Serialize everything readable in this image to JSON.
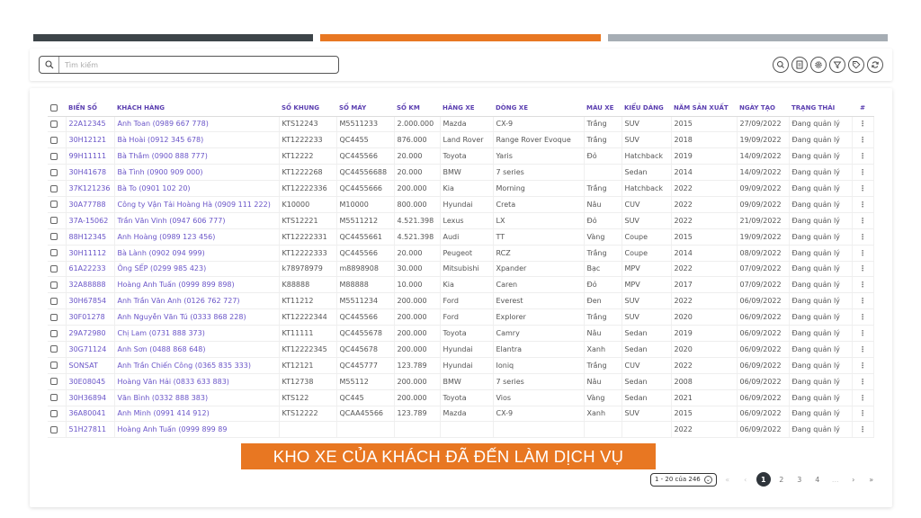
{
  "progress": {
    "colors": [
      "#3d4449",
      "#e87722",
      "#a6adb4"
    ]
  },
  "search": {
    "placeholder": "Tìm kiếm"
  },
  "toolbar": {
    "actions": [
      "search-icon",
      "document-icon",
      "settings-icon",
      "filter-icon",
      "tag-icon",
      "refresh-icon"
    ]
  },
  "table": {
    "headers": [
      "BIỂN SỐ",
      "KHÁCH HÀNG",
      "SỐ KHUNG",
      "SỐ MÁY",
      "SỐ KM",
      "HÃNG XE",
      "DÒNG XE",
      "MÀU XE",
      "KIỂU DÁNG",
      "NĂM SẢN XUẤT",
      "NGÀY TẠO",
      "TRẠNG THÁI",
      "#"
    ],
    "rows": [
      [
        "22A12345",
        "Anh Toan (0989 667 778)",
        "KTS12243",
        "M5511233",
        "2.000.000",
        "Mazda",
        "CX-9",
        "Trắng",
        "SUV",
        "2015",
        "27/09/2022",
        "Đang quản lý"
      ],
      [
        "30H12121",
        "Bà Hoài (0912 345 678)",
        "KT1222233",
        "QC4455",
        "876.000",
        "Land Rover",
        "Range Rover Evoque",
        "Trắng",
        "SUV",
        "2018",
        "19/09/2022",
        "Đang quản lý"
      ],
      [
        "99H11111",
        "Bà Thắm (0900 888 777)",
        "KT12222",
        "QC445566",
        "20.000",
        "Toyota",
        "Yaris",
        "Đỏ",
        "Hatchback",
        "2019",
        "14/09/2022",
        "Đang quản lý"
      ],
      [
        "30H41678",
        "Bà Tình (0900 909 000)",
        "KT1222268",
        "QC44556688",
        "20.000",
        "BMW",
        "7 series",
        "",
        "Sedan",
        "2014",
        "14/09/2022",
        "Đang quản lý"
      ],
      [
        "37K121236",
        "Bà To (0901 102 20)",
        "KT12222336",
        "QC4455666",
        "200.000",
        "Kia",
        "Morning",
        "Trắng",
        "Hatchback",
        "2022",
        "09/09/2022",
        "Đang quản lý"
      ],
      [
        "30A77788",
        "Công ty Vận Tải Hoàng Hà (0909 111 222)",
        "K10000",
        "M10000",
        "800.000",
        "Hyundai",
        "Creta",
        "Nâu",
        "CUV",
        "2022",
        "09/09/2022",
        "Đang quản lý"
      ],
      [
        "37A-15062",
        "Trần Văn Vinh (0947 606 777)",
        "KTS12221",
        "M5511212",
        "4.521.398",
        "Lexus",
        "LX",
        "Đỏ",
        "SUV",
        "2022",
        "21/09/2022",
        "Đang quản lý"
      ],
      [
        "88H12345",
        "Anh Hoàng (0989 123 456)",
        "KT12222331",
        "QC4455661",
        "4.521.398",
        "Audi",
        "TT",
        "Vàng",
        "Coupe",
        "2015",
        "19/09/2022",
        "Đang quản lý"
      ],
      [
        "30H11112",
        "Bà Lành (0902 094 999)",
        "KT12222333",
        "QC445566",
        "20.000",
        "Peugeot",
        "RCZ",
        "Trắng",
        "Coupe",
        "2014",
        "08/09/2022",
        "Đang quản lý"
      ],
      [
        "61A22233",
        "Ông SẾP (0299 985 423)",
        "k78978979",
        "m8898908",
        "30.000",
        "Mitsubishi",
        "Xpander",
        "Bạc",
        "MPV",
        "2022",
        "07/09/2022",
        "Đang quản lý"
      ],
      [
        "32A88888",
        "Hoàng Anh Tuấn (0999 899 898)",
        "K88888",
        "M88888",
        "10.000",
        "Kia",
        "Caren",
        "Đỏ",
        "MPV",
        "2017",
        "07/09/2022",
        "Đang quản lý"
      ],
      [
        "30H67854",
        "Anh Trần Văn Anh (0126 762 727)",
        "KT11212",
        "M5511234",
        "200.000",
        "Ford",
        "Everest",
        "Đen",
        "SUV",
        "2022",
        "06/09/2022",
        "Đang quản lý"
      ],
      [
        "30F01278",
        "Anh Nguyễn Văn Tú (0333 868 228)",
        "KT12222344",
        "QC445566",
        "200.000",
        "Ford",
        "Explorer",
        "Trắng",
        "SUV",
        "2020",
        "06/09/2022",
        "Đang quản lý"
      ],
      [
        "29A72980",
        "Chị Lam (0731 888 373)",
        "KT11111",
        "QC4455678",
        "200.000",
        "Toyota",
        "Camry",
        "Nâu",
        "Sedan",
        "2019",
        "06/09/2022",
        "Đang quản lý"
      ],
      [
        "30G71124",
        "Anh Sơn (0488 868 648)",
        "KT12222345",
        "QC445678",
        "200.000",
        "Hyundai",
        "Elantra",
        "Xanh",
        "Sedan",
        "2020",
        "06/09/2022",
        "Đang quản lý"
      ],
      [
        "SONSAT",
        "Anh Trần Chiến Công (0365 835 333)",
        "KT12121",
        "QC445777",
        "123.789",
        "Hyundai",
        "Ioniq",
        "Trắng",
        "CUV",
        "2022",
        "06/09/2022",
        "Đang quản lý"
      ],
      [
        "30E08045",
        "Hoàng Văn Hải (0833 633 883)",
        "KT12738",
        "M55112",
        "200.000",
        "BMW",
        "7 series",
        "Nâu",
        "Sedan",
        "2008",
        "06/09/2022",
        "Đang quản lý"
      ],
      [
        "30H36894",
        "Văn Bình (0332 888 383)",
        "KTS122",
        "QC445",
        "200.000",
        "Toyota",
        "Vios",
        "Vàng",
        "Sedan",
        "2021",
        "06/09/2022",
        "Đang quản lý"
      ],
      [
        "36A80041",
        "Anh Minh (0991 414 912)",
        "KTS12222",
        "QCAA45566",
        "123.789",
        "Mazda",
        "CX-9",
        "Xanh",
        "SUV",
        "2015",
        "06/09/2022",
        "Đang quản lý"
      ],
      [
        "51H27811",
        "Hoàng Anh Tuấn (0999 899 89",
        "",
        "",
        "",
        "",
        "",
        "",
        "",
        "2022",
        "06/09/2022",
        "Đang quản lý"
      ]
    ]
  },
  "banner": {
    "text": "KHO XE CỦA KHÁCH ĐÃ ĐẾN LÀM DỊCH VỤ"
  },
  "pagination": {
    "page_size_label": "1 - 20 của 246",
    "first": "«",
    "prev": "‹",
    "pages": [
      "1",
      "2",
      "3",
      "4",
      "..."
    ],
    "next": "›",
    "last": "»",
    "current": "1"
  }
}
